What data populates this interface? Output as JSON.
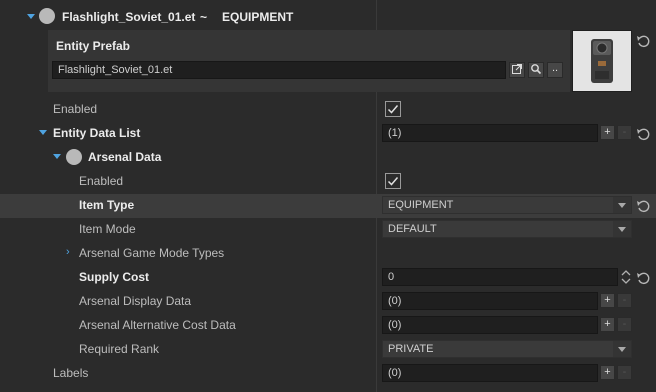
{
  "header": {
    "entity_name": "Flashlight_Soviet_01.et",
    "separator": "~",
    "category": "EQUIPMENT"
  },
  "prefab": {
    "title": "Entity Prefab",
    "path_value": "Flashlight_Soviet_01.et",
    "browse_label": ".."
  },
  "rows": {
    "enabled_label": "Enabled",
    "entity_data_list_label": "Entity Data List",
    "entity_data_list_value": "(1)",
    "arsenal_data_label": "Arsenal Data",
    "arsenal_enabled_label": "Enabled",
    "item_type_label": "Item Type",
    "item_type_value": "EQUIPMENT",
    "item_mode_label": "Item Mode",
    "item_mode_value": "DEFAULT",
    "game_mode_types_label": "Arsenal Game Mode Types",
    "supply_cost_label": "Supply Cost",
    "supply_cost_value": "0",
    "display_data_label": "Arsenal Display Data",
    "display_data_value": "(0)",
    "alt_cost_label": "Arsenal Alternative Cost Data",
    "alt_cost_value": "(0)",
    "required_rank_label": "Required Rank",
    "required_rank_value": "PRIVATE",
    "labels_label": "Labels",
    "labels_value": "(0)"
  },
  "buttons": {
    "add": "+",
    "remove": "-"
  },
  "colors": {
    "accent": "#4fa3e0",
    "background": "#2b2b2b",
    "highlight_row": "#3c3c3c"
  }
}
